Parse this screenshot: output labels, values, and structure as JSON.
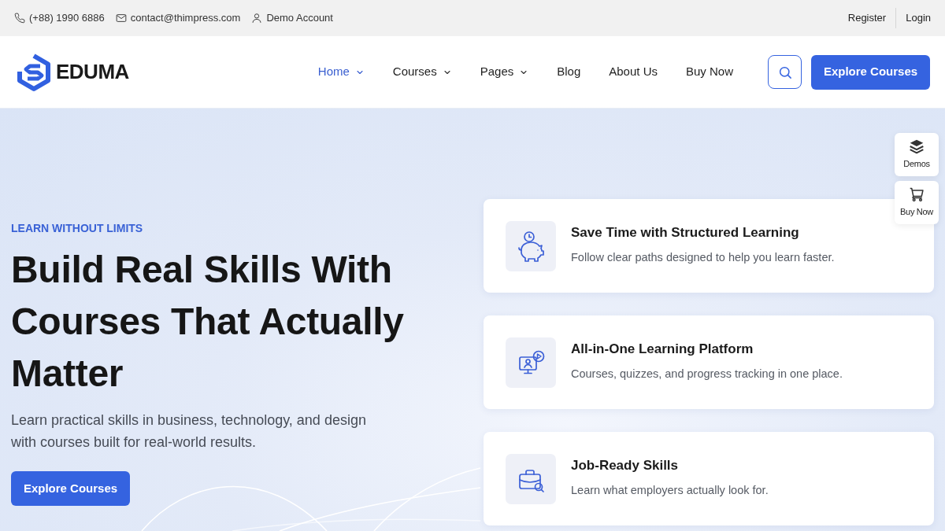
{
  "top_bar": {
    "contacts": [
      {
        "kind": "phone",
        "text": "(+88) 1990 6886"
      },
      {
        "kind": "email",
        "text": "contact@thimpress.com"
      },
      {
        "kind": "account",
        "text": "Demo Account"
      }
    ],
    "links": [
      "Register",
      "Login"
    ]
  },
  "header": {
    "logo": "EDUMA",
    "nav": [
      {
        "label": "Home",
        "selected": true,
        "dropdown": true
      },
      {
        "label": "Courses",
        "selected": false,
        "dropdown": true
      },
      {
        "label": "Pages",
        "selected": false,
        "dropdown": true
      },
      {
        "label": "Blog",
        "selected": false,
        "dropdown": false
      },
      {
        "label": "About Us",
        "selected": false,
        "dropdown": false
      },
      {
        "label": "Buy Now",
        "selected": false,
        "dropdown": false
      }
    ],
    "cta": "Explore Courses"
  },
  "side_widgets": [
    {
      "kind": "layers",
      "label": "Demos"
    },
    {
      "kind": "cart",
      "label": "Buy Now"
    }
  ],
  "hero": {
    "eyebrow": "LEARN WITHOUT LIMITS",
    "title": "Build Real Skills With Courses That Actually Matter",
    "description": "Learn practical skills in business, technology, and design with courses built for real-world results.",
    "button": "Explore Courses"
  },
  "features": [
    {
      "kind": "piggy-bank",
      "title": "Save Time with Structured Learning",
      "description": "Follow clear paths designed to help you learn faster."
    },
    {
      "kind": "monitor",
      "title": "All-in-One Learning Platform",
      "description": "Courses, quizzes, and progress tracking in one place."
    },
    {
      "kind": "briefcase",
      "title": "Job-Ready Skills",
      "description": "Learn what employers actually look for."
    }
  ]
}
